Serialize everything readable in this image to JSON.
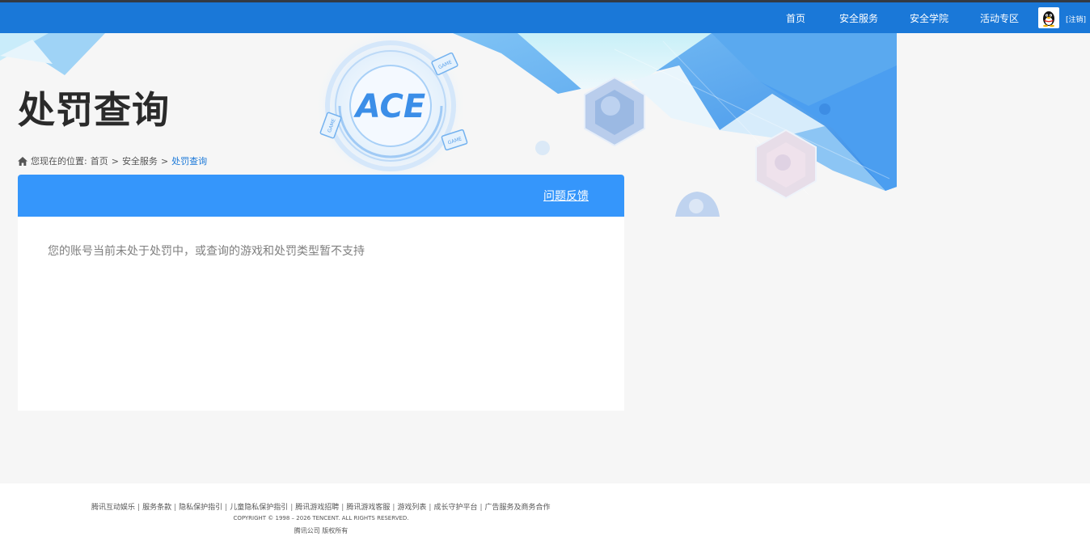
{
  "nav": {
    "items": [
      {
        "label": "首页"
      },
      {
        "label": "安全服务"
      },
      {
        "label": "安全学院"
      },
      {
        "label": "活动专区"
      }
    ],
    "login_label": "[注销]"
  },
  "banner": {
    "badge_text": "ACE",
    "sticker_text": "GAME"
  },
  "page": {
    "title": "处罚查询"
  },
  "breadcrumb": {
    "prefix": "您现在的位置:",
    "items": [
      "首页",
      "安全服务",
      "处罚查询"
    ],
    "separator": ">"
  },
  "panel": {
    "feedback_label": "问题反馈",
    "result_message": "您的账号当前未处于处罚中，或查询的游戏和处罚类型暂不支持"
  },
  "footer": {
    "links": [
      "腾讯互动娱乐",
      "服务条款",
      "隐私保护指引",
      "儿童隐私保护指引",
      "腾讯游戏招聘",
      "腾讯游戏客服",
      "游戏列表",
      "成长守护平台",
      "广告服务及商务合作"
    ],
    "copyright": "COPYRIGHT © 1998 – 2026 TENCENT. ALL RIGHTS RESERVED.",
    "owner": "腾讯公司 版权所有"
  },
  "colors": {
    "nav_bg": "#1a78d8",
    "panel_head": "#3596fb",
    "page_bg": "#f6f6f6",
    "breadcrumb_current": "#1a78d8"
  }
}
